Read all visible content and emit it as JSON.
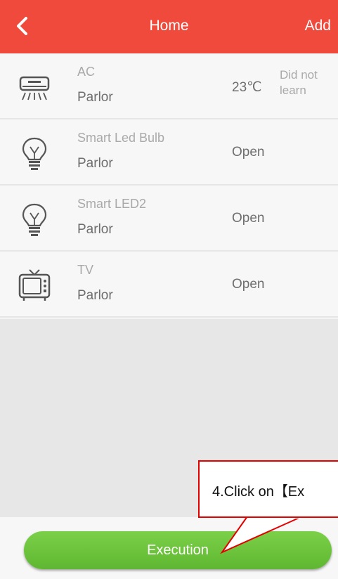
{
  "header": {
    "title": "Home",
    "add_label": "Add"
  },
  "devices": [
    {
      "name": "AC",
      "room": "Parlor",
      "temperature": "23℃",
      "learn_status": "Did not learn",
      "icon": "air-conditioner-icon"
    },
    {
      "name": "Smart Led Bulb",
      "room": "Parlor",
      "status": "Open",
      "icon": "light-bulb-icon"
    },
    {
      "name": "Smart LED2",
      "room": "Parlor",
      "status": "Open",
      "icon": "light-bulb-icon"
    },
    {
      "name": "TV",
      "room": "Parlor",
      "status": "Open",
      "icon": "tv-icon"
    }
  ],
  "footer": {
    "execute_label": "Execution"
  },
  "annotation": {
    "text": "4.Click on【Ex"
  },
  "colors": {
    "header": "#ef4a3b",
    "button": "#6ac33b",
    "callout_border": "#e50000"
  }
}
